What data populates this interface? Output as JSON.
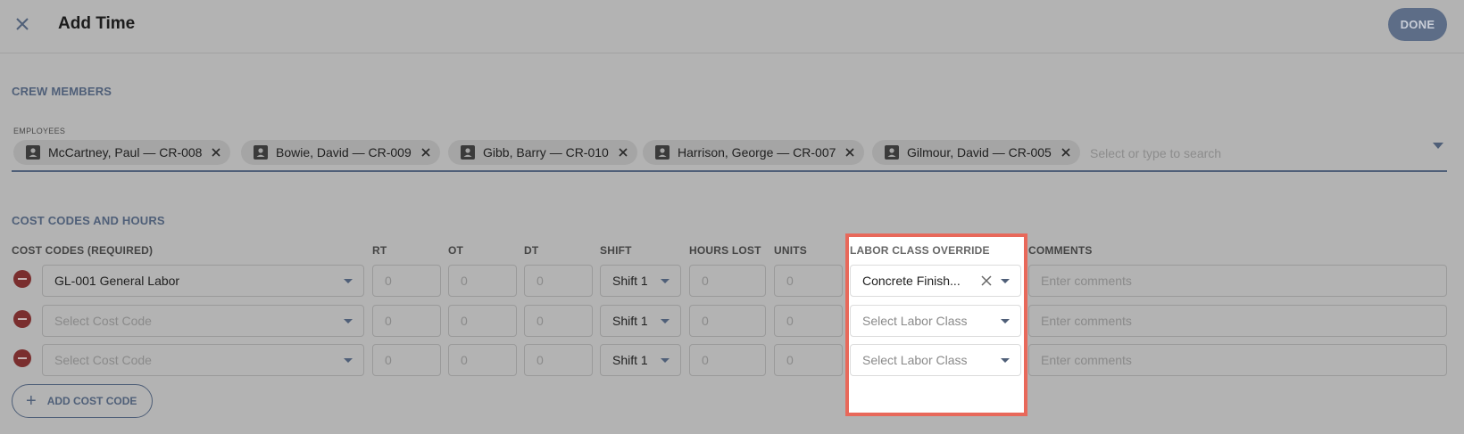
{
  "header": {
    "title": "Add Time",
    "done_label": "DONE"
  },
  "crew": {
    "section_title": "CREW MEMBERS",
    "employees_label": "EMPLOYEES",
    "chips": [
      "McCartney, Paul — CR-008",
      "Bowie, David — CR-009",
      "Gibb, Barry — CR-010",
      "Harrison, George — CR-007",
      "Gilmour, David — CR-005"
    ],
    "search_placeholder": "Select or type to search"
  },
  "costs": {
    "section_title": "COST CODES AND HOURS",
    "columns": {
      "cost_codes": "COST CODES (REQUIRED)",
      "rt": "RT",
      "ot": "OT",
      "dt": "DT",
      "shift": "SHIFT",
      "hours_lost": "HOURS LOST",
      "units": "UNITS",
      "labor_class": "LABOR CLASS OVERRIDE",
      "comments": "COMMENTS"
    },
    "rows": [
      {
        "cost_code": "GL-001 General Labor",
        "rt": "0",
        "ot": "0",
        "dt": "0",
        "shift": "Shift 1",
        "hours_lost": "0",
        "units": "0",
        "labor_class": "Concrete Finish...",
        "comments_placeholder": "Enter comments"
      },
      {
        "cost_code": "Select Cost Code",
        "rt": "0",
        "ot": "0",
        "dt": "0",
        "shift": "Shift 1",
        "hours_lost": "0",
        "units": "0",
        "labor_class": "Select Labor Class",
        "comments_placeholder": "Enter comments"
      },
      {
        "cost_code": "Select Cost Code",
        "rt": "0",
        "ot": "0",
        "dt": "0",
        "shift": "Shift 1",
        "hours_lost": "0",
        "units": "0",
        "labor_class": "Select Labor Class",
        "comments_placeholder": "Enter comments"
      }
    ],
    "add_label": "ADD COST CODE"
  },
  "colors": {
    "accent": "#4f5f78",
    "remove": "#7a2e2e",
    "highlight": "#e8685a",
    "background": "#b3b3b3"
  }
}
